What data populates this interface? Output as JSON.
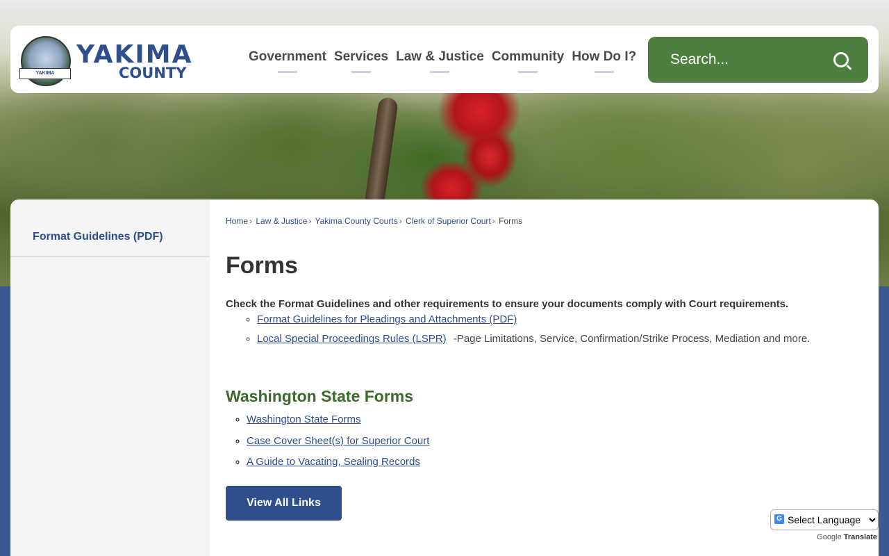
{
  "header": {
    "logo": {
      "main": "YAKIMA",
      "sub": "COUNTY",
      "seal_banner": "YAKIMA"
    },
    "nav": [
      "Government",
      "Services",
      "Law & Justice",
      "Community",
      "How Do I?"
    ],
    "search": {
      "placeholder": "Search..."
    }
  },
  "sidebar": {
    "items": [
      {
        "label": "Format Guidelines (PDF)"
      }
    ]
  },
  "breadcrumb": {
    "links": [
      "Home",
      "Law & Justice",
      "Yakima County Courts",
      "Clerk of Superior Court"
    ],
    "current": "Forms"
  },
  "main": {
    "title": "Forms",
    "intro": "Check the Format Guidelines and other requirements to ensure your documents comply with Court requirements.",
    "list_a": [
      {
        "link": "Format Guidelines for Pleadings and Attachments (PDF)",
        "desc": ""
      },
      {
        "link": "Local Special Proceedings Rules (LSPR)",
        "desc": "-Page Limitations, Service, Confirmation/Strike Process, Mediation and more."
      }
    ],
    "section_title": "Washington State Forms",
    "list_b": [
      "Washington State Forms",
      "Case Cover Sheet(s) for Superior Court",
      "A Guide to Vacating, Sealing Records"
    ],
    "view_all": "View All Links"
  },
  "translate": {
    "select": "Select Language",
    "powered_prefix": "Google",
    "powered_word": "Translate"
  },
  "colors": {
    "brand_blue": "#2e4f8c",
    "search_green": "#4f7f3f",
    "heading_green": "#3a6a2c"
  }
}
